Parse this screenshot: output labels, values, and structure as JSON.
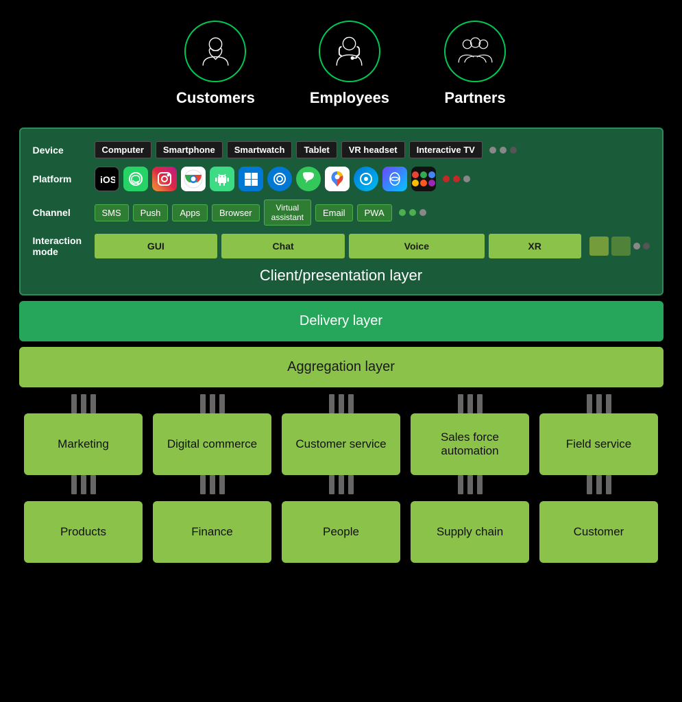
{
  "personas": [
    {
      "id": "customers",
      "label": "Customers",
      "icon": "customer"
    },
    {
      "id": "employees",
      "label": "Employees",
      "icon": "employee"
    },
    {
      "id": "partners",
      "label": "Partners",
      "icon": "partners"
    }
  ],
  "clientLayer": {
    "title": "Client/presentation layer",
    "rows": {
      "device": {
        "label": "Device",
        "items": [
          "Computer",
          "Smartphone",
          "Smartwatch",
          "Tablet",
          "VR headset",
          "Interactive TV"
        ]
      },
      "channel": {
        "label": "Channel",
        "items": [
          "SMS",
          "Push",
          "Apps",
          "Browser",
          "Virtual assistant",
          "Email",
          "PWA"
        ]
      },
      "interactionMode": {
        "label": "Interaction mode",
        "items": [
          "GUI",
          "Chat",
          "Voice",
          "XR"
        ]
      }
    }
  },
  "deliveryLayer": {
    "label": "Delivery layer"
  },
  "aggregationLayer": {
    "label": "Aggregation layer"
  },
  "topBoxes": [
    {
      "label": "Marketing"
    },
    {
      "label": "Digital commerce"
    },
    {
      "label": "Customer service"
    },
    {
      "label": "Sales force automation"
    },
    {
      "label": "Field service"
    }
  ],
  "bottomBoxes": [
    {
      "label": "Products"
    },
    {
      "label": "Finance"
    },
    {
      "label": "People"
    },
    {
      "label": "Supply chain"
    },
    {
      "label": "Customer"
    }
  ]
}
